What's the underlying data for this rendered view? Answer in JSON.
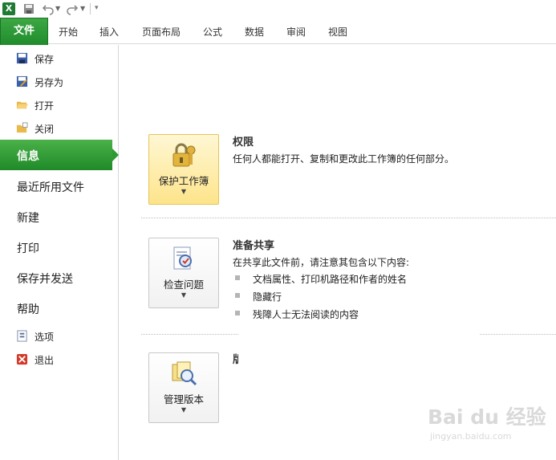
{
  "app": {
    "logo": "X"
  },
  "quick_access": {
    "items": [
      "save-icon",
      "undo-icon",
      "redo-icon",
      "customize-icon"
    ]
  },
  "ribbon": {
    "file_tab": "文件",
    "tabs": [
      "开始",
      "插入",
      "页面布局",
      "公式",
      "数据",
      "审阅",
      "视图"
    ]
  },
  "nav": {
    "commands": [
      {
        "label": "保存",
        "icon": "save-icon"
      },
      {
        "label": "另存为",
        "icon": "save-as-icon"
      },
      {
        "label": "打开",
        "icon": "open-folder-icon"
      },
      {
        "label": "关闭",
        "icon": "close-folder-icon"
      }
    ],
    "active": "信息",
    "items": [
      "最近所用文件",
      "新建",
      "打印",
      "保存并发送",
      "帮助"
    ],
    "bottom": [
      {
        "label": "选项",
        "icon": "options-icon"
      },
      {
        "label": "退出",
        "icon": "exit-icon"
      }
    ]
  },
  "sections": {
    "permissions": {
      "button": "保护工作簿",
      "title": "权限",
      "desc": "任何人都能打开、复制和更改此工作簿的任何部分。"
    },
    "prepare": {
      "button": "检查问题",
      "title": "准备共享",
      "desc": "在共享此文件前，请注意其包含以下内容:",
      "bullets": [
        "文档属性、打印机路径和作者的姓名",
        "隐藏行",
        "残障人士无法阅读的内容"
      ]
    },
    "versions": {
      "button": "管理版本",
      "title": "版"
    }
  },
  "watermark": {
    "main": "Bai du 经验",
    "sub": "jingyan.baidu.com"
  },
  "colors": {
    "accent_green": "#2e9b32",
    "highlight": "#fde48a"
  }
}
